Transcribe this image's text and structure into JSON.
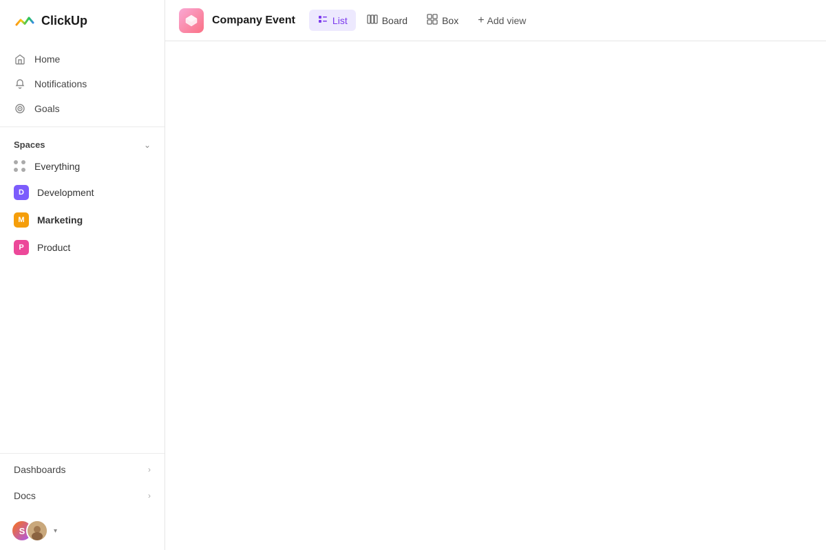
{
  "app": {
    "name": "ClickUp"
  },
  "sidebar": {
    "nav": [
      {
        "id": "home",
        "label": "Home",
        "icon": "home"
      },
      {
        "id": "notifications",
        "label": "Notifications",
        "icon": "bell"
      },
      {
        "id": "goals",
        "label": "Goals",
        "icon": "target"
      }
    ],
    "spaces_label": "Spaces",
    "spaces": [
      {
        "id": "everything",
        "label": "Everything",
        "type": "grid"
      },
      {
        "id": "development",
        "label": "Development",
        "color": "#7c5cfc",
        "initial": "D"
      },
      {
        "id": "marketing",
        "label": "Marketing",
        "color": "#f59e0b",
        "initial": "M",
        "bold": true
      },
      {
        "id": "product",
        "label": "Product",
        "color": "#ec4899",
        "initial": "P"
      }
    ],
    "bottom": [
      {
        "id": "dashboards",
        "label": "Dashboards"
      },
      {
        "id": "docs",
        "label": "Docs"
      }
    ],
    "user": {
      "initials": "S",
      "arrow": "▾"
    }
  },
  "topbar": {
    "project_title": "Company Event",
    "views": [
      {
        "id": "list",
        "label": "List",
        "icon": "≡",
        "active": true
      },
      {
        "id": "board",
        "label": "Board",
        "icon": "⊞"
      },
      {
        "id": "box",
        "label": "Box",
        "icon": "⊠"
      }
    ],
    "add_view_label": "Add view"
  }
}
